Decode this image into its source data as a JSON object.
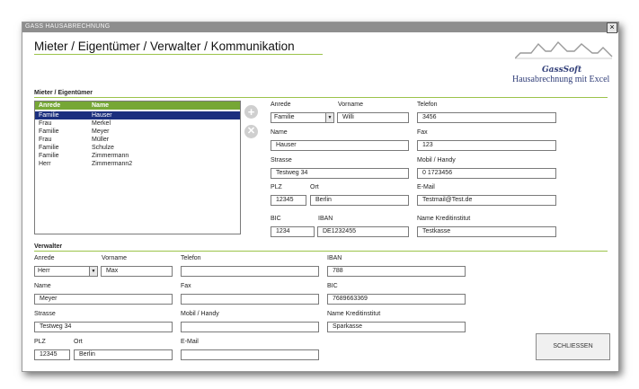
{
  "window": {
    "title": "GASS HAUSABRECHNUNG",
    "close": "×"
  },
  "page_title": "Mieter / Eigentümer / Verwalter / Kommunikation",
  "logo": {
    "name": "GassSoft",
    "tagline": "Hausabrechnung mit Excel"
  },
  "tenants": {
    "section_title": "Mieter / Eigentümer",
    "columns": [
      "Anrede",
      "Name"
    ],
    "rows": [
      [
        "Familie",
        "Hauser"
      ],
      [
        "Frau",
        "Merkel"
      ],
      [
        "Familie",
        "Meyer"
      ],
      [
        "Frau",
        "Müller"
      ],
      [
        "Familie",
        "Schulze"
      ],
      [
        "Familie",
        "Zimmermann"
      ],
      [
        "Herr",
        "Zimmermann2"
      ]
    ],
    "selected_index": 0,
    "add_icon": "plus-circle-icon",
    "remove_icon": "x-circle-icon",
    "form": {
      "anrede_label": "Anrede",
      "anrede_value": "Familie",
      "vorname_label": "Vorname",
      "vorname_value": "Willi",
      "telefon_label": "Telefon",
      "telefon_value": "3456",
      "name_label": "Name",
      "name_value": "Hauser",
      "fax_label": "Fax",
      "fax_value": "123",
      "strasse_label": "Strasse",
      "strasse_value": "Testweg 34",
      "mobil_label": "Mobil / Handy",
      "mobil_value": "0 1723456",
      "plz_label": "PLZ",
      "plz_value": "12345",
      "ort_label": "Ort",
      "ort_value": "Berlin",
      "email_label": "E-Mail",
      "email_value": "Testmail@Test.de",
      "bic_label": "BIC",
      "bic_value": "1234",
      "iban_label": "IBAN",
      "iban_value": "DE1232455",
      "bank_label": "Name Kreditinstitut",
      "bank_value": "Testkasse"
    }
  },
  "manager": {
    "section_title": "Verwalter",
    "anrede_label": "Anrede",
    "anrede_value": "Herr",
    "vorname_label": "Vorname",
    "vorname_value": "Max",
    "telefon_label": "Telefon",
    "telefon_value": "",
    "iban_label": "IBAN",
    "iban_value": "788",
    "name_label": "Name",
    "name_value": "Meyer",
    "fax_label": "Fax",
    "fax_value": "",
    "bic_label": "BIC",
    "bic_value": "7689663369",
    "strasse_label": "Strasse",
    "strasse_value": "Testweg 34",
    "mobil_label": "Mobil / Handy",
    "mobil_value": "",
    "bank_label": "Name Kreditinstitut",
    "bank_value": "Sparkasse",
    "plz_label": "PLZ",
    "plz_value": "12345",
    "ort_label": "Ort",
    "ort_value": "Berlin",
    "email_label": "E-Mail",
    "email_value": ""
  },
  "close_button": "SCHLIESSEN",
  "colors": {
    "accent_green": "#76a736",
    "selection_blue": "#1b2f7e",
    "logo_blue": "#33407a"
  }
}
